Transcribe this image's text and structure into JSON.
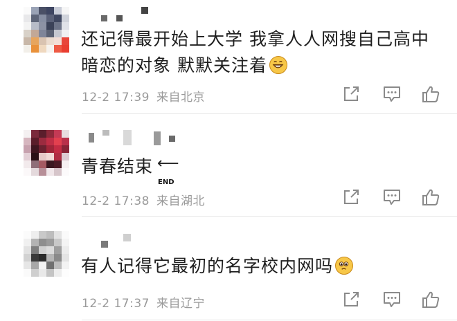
{
  "comments": [
    {
      "line1": "还记得最开始上大学 我拿人人网搜自己高中",
      "line2": "暗恋的对象 默默关注着",
      "emoji": "grinning-face-icon",
      "date": "12-2 17:39",
      "location": "来自北京"
    },
    {
      "line1": "青春结束",
      "end_label": "END",
      "emoji": "end-arrow-icon",
      "date": "12-2 17:38",
      "location": "来自湖北"
    },
    {
      "line1": "有人记得它最初的名字校内网吗",
      "emoji": "worried-face-icon",
      "date": "12-2 17:37",
      "location": "来自辽宁"
    }
  ],
  "colors": {
    "text": "#1f1f1f",
    "meta": "#9a9a9a",
    "icon": "#8a8a8a",
    "divider": "#e6e6e6"
  }
}
